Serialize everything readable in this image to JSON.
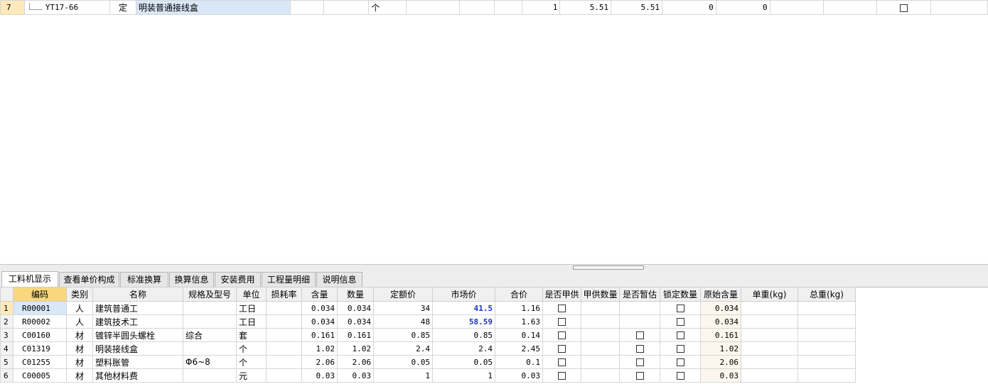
{
  "top_row": {
    "row_num": "7",
    "code": "YT17-66",
    "type": "定",
    "name": "明装普通接线盒",
    "unit": "个",
    "cells": [
      "1",
      "5.51",
      "5.51",
      "0",
      "0"
    ]
  },
  "tabs": [
    "工料机显示",
    "查看单价构成",
    "标准换算",
    "换算信息",
    "安装费用",
    "工程量明细",
    "说明信息"
  ],
  "active_tab": "工料机显示",
  "headers": {
    "code": "编码",
    "category": "类别",
    "name": "名称",
    "spec": "规格及型号",
    "unit": "单位",
    "loss": "损耗率",
    "content": "含量",
    "qty": "数量",
    "quota_price": "定额价",
    "market_price": "市场价",
    "total_price": "合价",
    "supplied": "是否甲供",
    "supplied_qty": "甲供数量",
    "estimate": "是否暂估",
    "locked_qty": "锁定数量",
    "orig_content": "原始含量",
    "unit_weight": "单重(kg)",
    "total_weight": "总重(kg)"
  },
  "rows": [
    {
      "n": "1",
      "code": "R00001",
      "cat": "人",
      "name": "建筑普通工",
      "spec": "",
      "unit": "工日",
      "content": "0.034",
      "qty": "0.034",
      "quota": "34",
      "market": "41.5",
      "total": "1.16",
      "orig": "0.034"
    },
    {
      "n": "2",
      "code": "R00002",
      "cat": "人",
      "name": "建筑技术工",
      "spec": "",
      "unit": "工日",
      "content": "0.034",
      "qty": "0.034",
      "quota": "48",
      "market": "58.59",
      "total": "1.63",
      "orig": "0.034"
    },
    {
      "n": "3",
      "code": "C00160",
      "cat": "材",
      "name": "镀锌半圆头螺栓",
      "spec": "综合",
      "unit": "套",
      "content": "0.161",
      "qty": "0.161",
      "quota": "0.85",
      "market": "0.85",
      "total": "0.14",
      "orig": "0.161"
    },
    {
      "n": "4",
      "code": "C01319",
      "cat": "材",
      "name": "明装接线盒",
      "spec": "",
      "unit": "个",
      "content": "1.02",
      "qty": "1.02",
      "quota": "2.4",
      "market": "2.4",
      "total": "2.45",
      "orig": "1.02"
    },
    {
      "n": "5",
      "code": "C01255",
      "cat": "材",
      "name": "塑料胀管",
      "spec": "Φ6~8",
      "unit": "个",
      "content": "2.06",
      "qty": "2.06",
      "quota": "0.05",
      "market": "0.05",
      "total": "0.1",
      "orig": "2.06"
    },
    {
      "n": "6",
      "code": "C00005",
      "cat": "材",
      "name": "其他材料费",
      "spec": "",
      "unit": "元",
      "content": "0.03",
      "qty": "0.03",
      "quota": "1",
      "market": "1",
      "total": "0.03",
      "orig": "0.03"
    }
  ],
  "colors": {
    "row_head": "#fde9b9",
    "selected": "#d9e7f7",
    "header_highlight": "#f9d77e",
    "market_price_blue": "#1a32c8"
  }
}
